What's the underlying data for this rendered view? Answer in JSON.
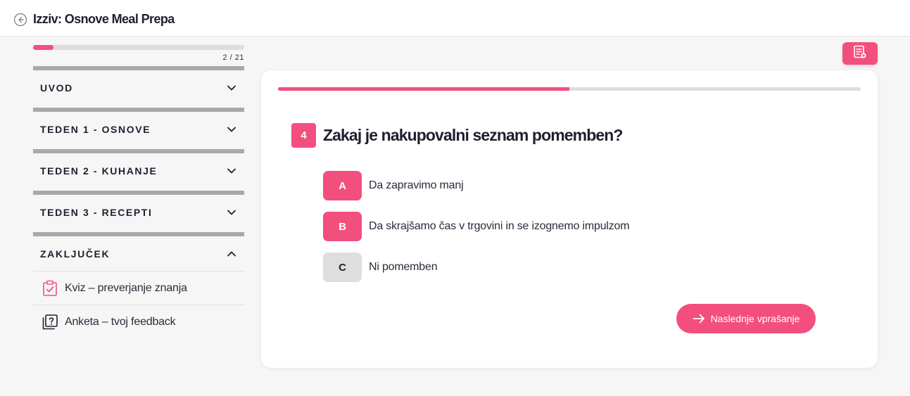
{
  "header": {
    "title": "Izziv: Osnove Meal Prepa",
    "back_icon": "circle-arrow-left-icon"
  },
  "sidebar": {
    "progress": {
      "current": 2,
      "total": 21,
      "label": "2 / 21",
      "fraction": 0.095
    },
    "sections": [
      {
        "label": "UVOD",
        "expanded": false
      },
      {
        "label": "TEDEN 1 - OSNOVE",
        "expanded": false
      },
      {
        "label": "TEDEN 2 - KUHANJE",
        "expanded": false
      },
      {
        "label": "TEDEN 3 - RECEPTI",
        "expanded": false
      },
      {
        "label": "ZAKLJUČEK",
        "expanded": true,
        "items": [
          {
            "label": "Kviz – preverjanje znanja",
            "icon": "clipboard-check-icon"
          },
          {
            "label": "Anketa – tvoj feedback",
            "icon": "question-square-icon"
          }
        ]
      }
    ]
  },
  "toolbar": {
    "notes_icon": "notes-icon"
  },
  "quiz": {
    "progress_fraction": 0.5,
    "question_number": "4",
    "question": "Zakaj je nakupovalni seznam pomemben?",
    "answers": [
      {
        "letter": "A",
        "text": "Da zapravimo manj"
      },
      {
        "letter": "B",
        "text": "Da skrajšamo čas v trgovini in se izognemo impulzom"
      },
      {
        "letter": "C",
        "text": "Ni pomemben"
      }
    ],
    "next_label": "Naslednje vprašanje"
  },
  "colors": {
    "accent": "#f34f7e",
    "text": "#1e2030",
    "muted": "#dedede",
    "section_bar": "#a9a9a9"
  }
}
